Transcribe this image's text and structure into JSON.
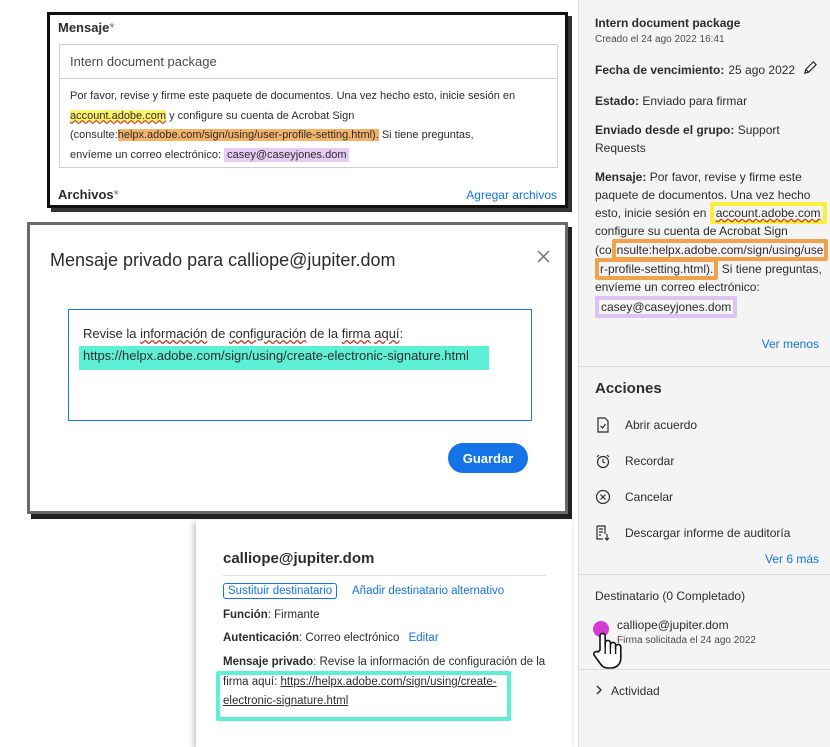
{
  "message_panel": {
    "message_label": "Mensaje",
    "required_mark": "*",
    "subject_value": "Intern document package",
    "body_parts": {
      "p1": "Por favor, revise y firme este paquete de documentos. Una vez hecho esto, inicie sesión en",
      "link1": "account.adobe.com",
      "p2": " y configure su cuenta de Acrobat Sign",
      "p3_open": "(consulte:",
      "link2": "helpx.adobe.com/sign/using/user-profile-setting.html).",
      "p4": " Si tiene preguntas,",
      "p5": "envíeme un correo electrónico: ",
      "link3": "casey@caseyjones.dom"
    },
    "files_label": "Archivos",
    "add_files_link": "Agregar archivos"
  },
  "modal": {
    "title": "Mensaje privado para calliope@jupiter.dom",
    "close_icon": "close-icon",
    "line1": "Revise la información de configuración de la firma aquí:",
    "line2": "https://helpx.adobe.com/sign/using/create-electronic-signature.html",
    "save_button": "Guardar"
  },
  "popup": {
    "recipient": "calliope@jupiter.dom",
    "replace_button": "Sustituir destinatario",
    "add_alt_link": "Añadir destinatario alternativo",
    "role_label": "Función",
    "role_value": ": Firmante",
    "auth_label": "Autenticación",
    "auth_value": ": Correo electrónico",
    "edit_link": "Editar",
    "private_label": "Mensaje privado",
    "private_text": ": Revise la información de configuración de la",
    "private_text2": "firma aquí: ",
    "private_link1": "https://helpx.adobe.com/sign/using/create-",
    "private_link2": "electronic-signature.html"
  },
  "sidebar": {
    "title": "Intern document package",
    "created": "Creado el 24 ago 2022 16:41",
    "due_label": "Fecha de vencimiento:",
    "due_value": "25 ago 2022",
    "status_label": "Estado:",
    "status_value": "Enviado para firmar",
    "group_label": "Enviado desde el grupo:",
    "group_value1": "Support",
    "group_value2": "Requests",
    "msg_label": "Mensaje:",
    "msg_line1": "Por favor, revise y firme este",
    "msg_line2": "paquete de documentos. Una vez hecho",
    "msg_line3_a": "esto, inicie sesión en",
    "msg_link1": "account.adobe.com",
    "msg_line4": "configure su cuenta de Acrobat Sign",
    "msg_line5_a": "(co",
    "msg_link2a": "nsulte:helpx.adobe.com/sign/using/use",
    "msg_link2b": "r-profile-setting.html).",
    "msg_line6_b": " Si tiene preguntas,",
    "msg_line7": "envíeme un correo electrónico:",
    "msg_link3": "casey@caseyjones.dom",
    "see_less": "Ver menos",
    "actions_title": "Acciones",
    "actions": [
      {
        "label": "Abrir acuerdo",
        "icon": "document-check-icon"
      },
      {
        "label": "Recordar",
        "icon": "alarm-clock-icon"
      },
      {
        "label": "Cancelar",
        "icon": "cancel-circle-icon"
      },
      {
        "label": "Descargar informe de auditoría",
        "icon": "audit-report-icon"
      }
    ],
    "see_more": "Ver 6 más",
    "recipients_title": "Destinatario (0 Completado)",
    "recipient_email": "calliope@jupiter.dom",
    "recipient_sub": "Firma solicitada el 24 ago 2022",
    "activity": "Actividad"
  },
  "colors": {
    "accent": "#1473e6",
    "highlight_yellow": "#fdf26a",
    "highlight_orange": "#f5b36a",
    "highlight_purple": "#e6ccf4",
    "highlight_teal": "#5ef0d6",
    "avatar_magenta": "#d23ad1"
  }
}
